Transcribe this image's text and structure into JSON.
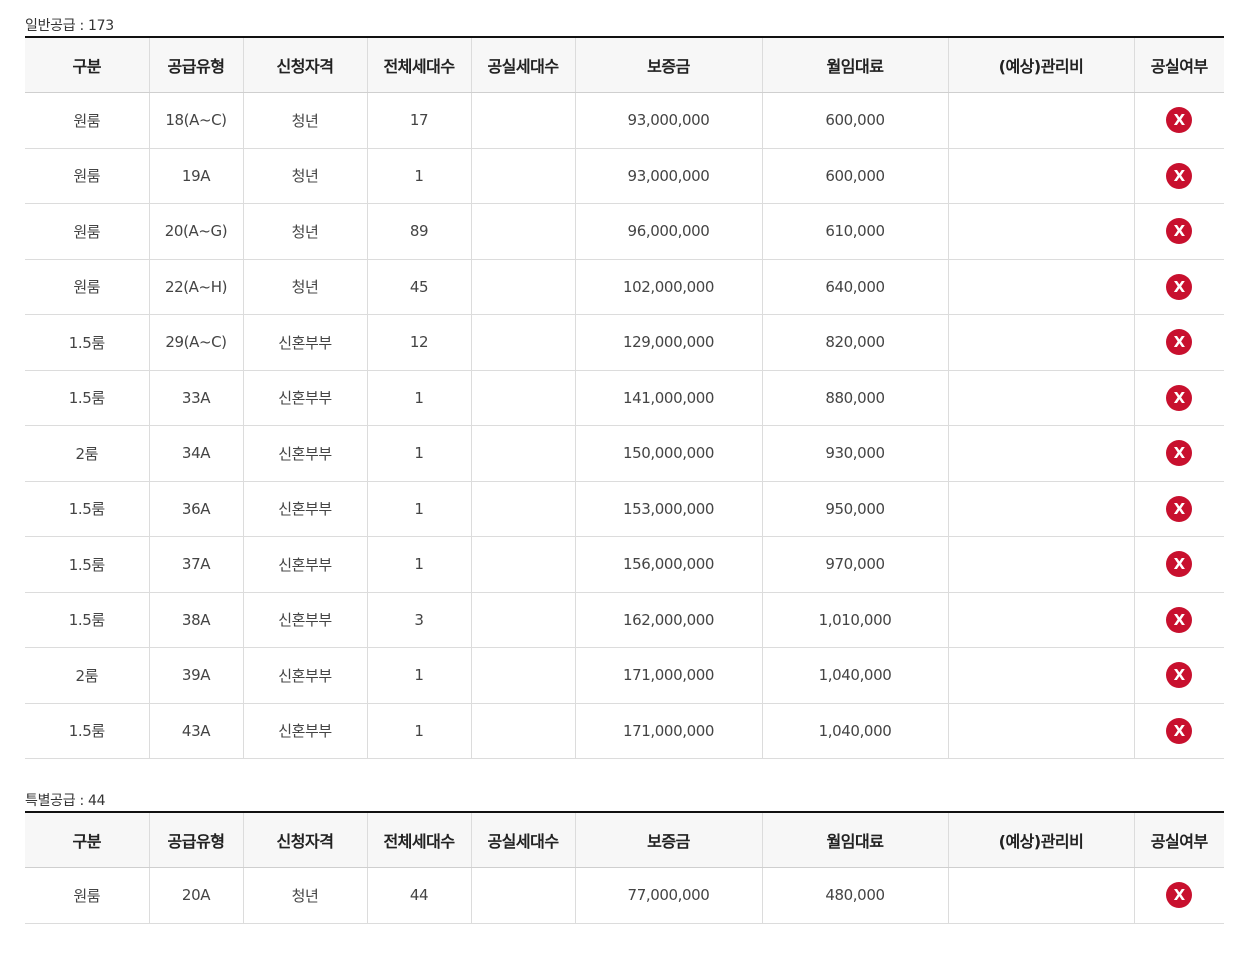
{
  "columns": [
    "구분",
    "공급유형",
    "신청자격",
    "전체세대수",
    "공실세대수",
    "보증금",
    "월임대료",
    "(예상)관리비",
    "공실여부"
  ],
  "general": {
    "title": "일반공급 : 173",
    "rows": [
      {
        "type": "원룸",
        "supply": "18(A~C)",
        "qual": "청년",
        "total": "17",
        "vacant": "",
        "deposit": "93,000,000",
        "rent": "600,000",
        "fee": "",
        "vacancy_icon": "x-icon"
      },
      {
        "type": "원룸",
        "supply": "19A",
        "qual": "청년",
        "total": "1",
        "vacant": "",
        "deposit": "93,000,000",
        "rent": "600,000",
        "fee": "",
        "vacancy_icon": "x-icon"
      },
      {
        "type": "원룸",
        "supply": "20(A~G)",
        "qual": "청년",
        "total": "89",
        "vacant": "",
        "deposit": "96,000,000",
        "rent": "610,000",
        "fee": "",
        "vacancy_icon": "x-icon"
      },
      {
        "type": "원룸",
        "supply": "22(A~H)",
        "qual": "청년",
        "total": "45",
        "vacant": "",
        "deposit": "102,000,000",
        "rent": "640,000",
        "fee": "",
        "vacancy_icon": "x-icon"
      },
      {
        "type": "1.5룸",
        "supply": "29(A~C)",
        "qual": "신혼부부",
        "total": "12",
        "vacant": "",
        "deposit": "129,000,000",
        "rent": "820,000",
        "fee": "",
        "vacancy_icon": "x-icon"
      },
      {
        "type": "1.5룸",
        "supply": "33A",
        "qual": "신혼부부",
        "total": "1",
        "vacant": "",
        "deposit": "141,000,000",
        "rent": "880,000",
        "fee": "",
        "vacancy_icon": "x-icon"
      },
      {
        "type": "2룸",
        "supply": "34A",
        "qual": "신혼부부",
        "total": "1",
        "vacant": "",
        "deposit": "150,000,000",
        "rent": "930,000",
        "fee": "",
        "vacancy_icon": "x-icon"
      },
      {
        "type": "1.5룸",
        "supply": "36A",
        "qual": "신혼부부",
        "total": "1",
        "vacant": "",
        "deposit": "153,000,000",
        "rent": "950,000",
        "fee": "",
        "vacancy_icon": "x-icon"
      },
      {
        "type": "1.5룸",
        "supply": "37A",
        "qual": "신혼부부",
        "total": "1",
        "vacant": "",
        "deposit": "156,000,000",
        "rent": "970,000",
        "fee": "",
        "vacancy_icon": "x-icon"
      },
      {
        "type": "1.5룸",
        "supply": "38A",
        "qual": "신혼부부",
        "total": "3",
        "vacant": "",
        "deposit": "162,000,000",
        "rent": "1,010,000",
        "fee": "",
        "vacancy_icon": "x-icon"
      },
      {
        "type": "2룸",
        "supply": "39A",
        "qual": "신혼부부",
        "total": "1",
        "vacant": "",
        "deposit": "171,000,000",
        "rent": "1,040,000",
        "fee": "",
        "vacancy_icon": "x-icon"
      },
      {
        "type": "1.5룸",
        "supply": "43A",
        "qual": "신혼부부",
        "total": "1",
        "vacant": "",
        "deposit": "171,000,000",
        "rent": "1,040,000",
        "fee": "",
        "vacancy_icon": "x-icon"
      }
    ]
  },
  "special": {
    "title": "특별공급 : 44",
    "rows": [
      {
        "type": "원룸",
        "supply": "20A",
        "qual": "청년",
        "total": "44",
        "vacant": "",
        "deposit": "77,000,000",
        "rent": "480,000",
        "fee": "",
        "vacancy_icon": "x-icon"
      }
    ]
  },
  "vacancy_symbol": "X",
  "colors": {
    "header_bg": "#f7f7f7",
    "top_border": "#111111",
    "vacancy_badge": "#c8102e"
  }
}
